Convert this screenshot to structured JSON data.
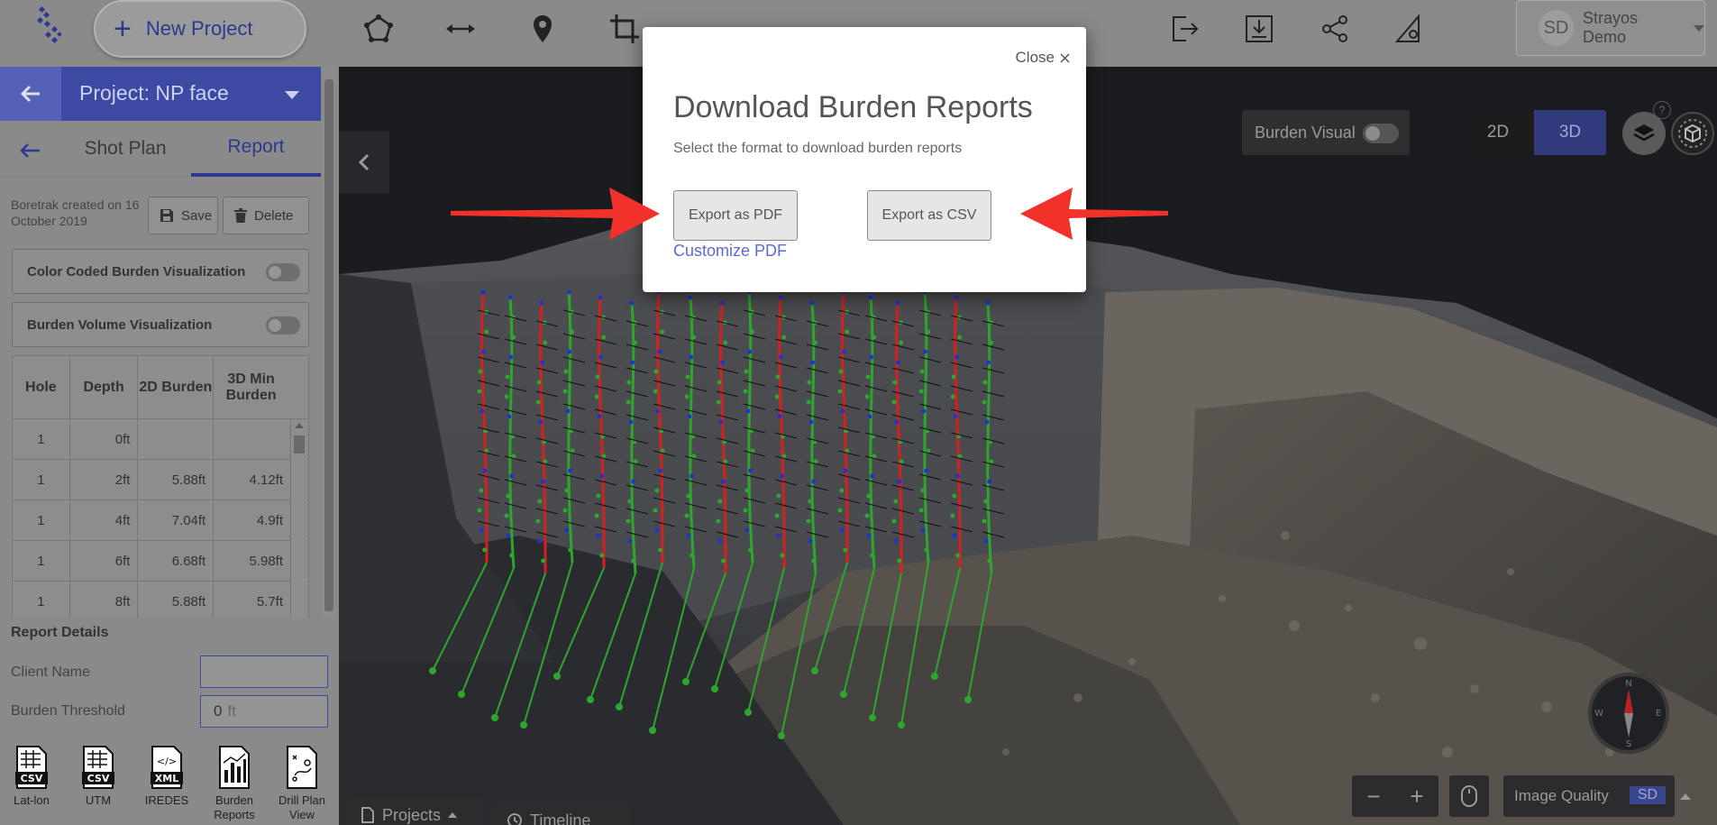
{
  "topbar": {
    "new_project_label": "New Project",
    "tools": [
      "polygon-icon",
      "measure-icon",
      "pin-icon",
      "crop-icon"
    ],
    "right_tools": [
      "export-icon",
      "download-icon",
      "share-icon",
      "settings-ruler-icon"
    ],
    "user_initials": "SD",
    "user_name": "Strayos Demo"
  },
  "sidebar": {
    "project_title": "Project: NP face",
    "tabs": [
      {
        "label": "Shot Plan",
        "active": false
      },
      {
        "label": "Report",
        "active": true
      }
    ],
    "boretrak_created": "Boretrak created on 16 October 2019",
    "save_label": "Save",
    "delete_label": "Delete",
    "viz_rows": [
      {
        "label": "Color Coded Burden Visualization",
        "enabled": false
      },
      {
        "label": "Burden Volume Visualization",
        "enabled": false
      }
    ],
    "table": {
      "headers": [
        "Hole",
        "Depth",
        "2D Burden",
        "3D Min Burden"
      ],
      "rows": [
        {
          "hole": "1",
          "depth": "0ft",
          "b2d": "",
          "b3d": ""
        },
        {
          "hole": "1",
          "depth": "2ft",
          "b2d": "5.88ft",
          "b3d": "4.12ft"
        },
        {
          "hole": "1",
          "depth": "4ft",
          "b2d": "7.04ft",
          "b3d": "4.9ft"
        },
        {
          "hole": "1",
          "depth": "6ft",
          "b2d": "6.68ft",
          "b3d": "5.98ft"
        },
        {
          "hole": "1",
          "depth": "8ft",
          "b2d": "5.88ft",
          "b3d": "5.7ft"
        }
      ]
    },
    "report_details": {
      "title": "Report Details",
      "client_name_label": "Client Name",
      "client_name_value": "",
      "burden_threshold_label": "Burden Threshold",
      "burden_threshold_value": "0",
      "burden_threshold_unit": "ft"
    },
    "exports": [
      {
        "label": "Lat-lon",
        "icon": "csv-file-icon",
        "tag": "CSV"
      },
      {
        "label": "UTM",
        "icon": "csv-file-icon",
        "tag": "CSV"
      },
      {
        "label": "IREDES",
        "icon": "xml-file-icon",
        "tag": "XML"
      },
      {
        "label": "Burden Reports",
        "icon": "report-chart-icon",
        "tag": ""
      },
      {
        "label": "Drill Plan View",
        "icon": "drill-plan-icon",
        "tag": ""
      }
    ]
  },
  "viewport": {
    "burden_visual_label": "Burden Visual",
    "burden_visual_on": false,
    "view_2d": "2D",
    "view_3d": "3D",
    "active_view": "3D",
    "help": "?",
    "compass": {
      "n": "N",
      "s": "S",
      "e": "E",
      "w": "W"
    },
    "zoom_out": "−",
    "zoom_in": "+",
    "image_quality_label": "Image Quality",
    "image_quality_value": "SD",
    "bottom_tabs": [
      "Projects",
      "Timeline"
    ]
  },
  "modal": {
    "close_label": "Close",
    "title": "Download Burden Reports",
    "subtitle": "Select the format to download burden reports",
    "export_pdf": "Export as PDF",
    "export_csv": "Export as CSV",
    "customize_pdf": "Customize PDF"
  },
  "colors": {
    "accent": "#3c4aa3",
    "link": "#5b6bd3",
    "annotation_arrow": "#f2322a",
    "hole_red": "#d42020",
    "hole_green": "#2ea52e",
    "hole_blue": "#2233cc"
  }
}
